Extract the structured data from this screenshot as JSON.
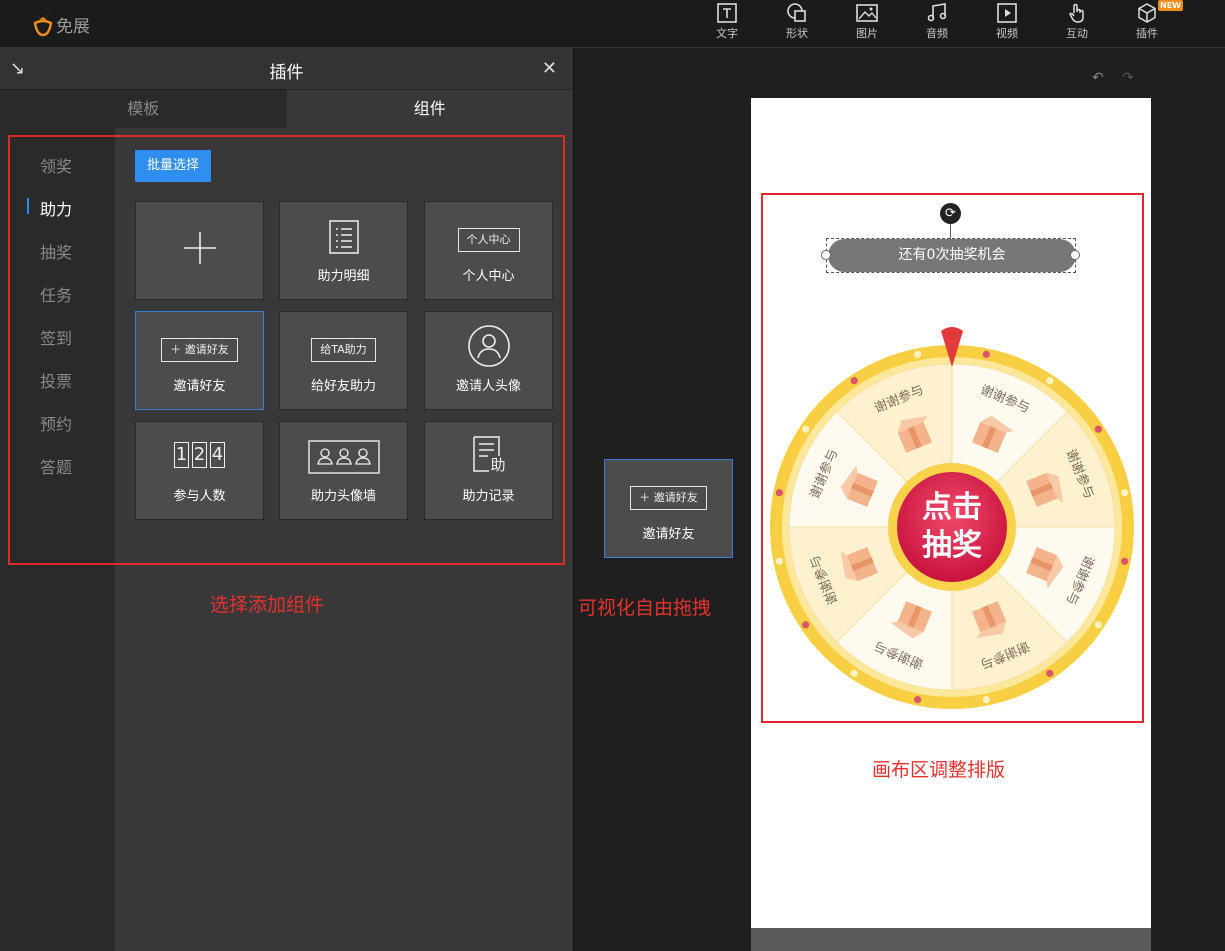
{
  "app": {
    "brand": "免展"
  },
  "toolbar": [
    {
      "label": "文字",
      "icon": "text-icon"
    },
    {
      "label": "形状",
      "icon": "shape-icon"
    },
    {
      "label": "图片",
      "icon": "image-icon"
    },
    {
      "label": "音频",
      "icon": "music-icon"
    },
    {
      "label": "视频",
      "icon": "video-icon"
    },
    {
      "label": "互动",
      "icon": "hand-icon"
    },
    {
      "label": "插件",
      "icon": "cube-icon",
      "badge": "NEW"
    }
  ],
  "panel": {
    "title": "插件",
    "tabs": [
      {
        "label": "模板",
        "active": false
      },
      {
        "label": "组件",
        "active": true
      }
    ],
    "categories": [
      {
        "label": "领奖",
        "active": false
      },
      {
        "label": "助力",
        "active": true
      },
      {
        "label": "抽奖",
        "active": false
      },
      {
        "label": "任务",
        "active": false
      },
      {
        "label": "签到",
        "active": false
      },
      {
        "label": "投票",
        "active": false
      },
      {
        "label": "预约",
        "active": false
      },
      {
        "label": "答题",
        "active": false
      }
    ],
    "batch_button": "批量选择",
    "components": [
      {
        "label": "",
        "icon": "plus-icon"
      },
      {
        "label": "助力明细",
        "icon": "list-icon"
      },
      {
        "label": "个人中心",
        "icon": "personal-center-button-icon",
        "preview": "个人中心"
      },
      {
        "label": "邀请好友",
        "icon": "invite-button-icon",
        "preview": "邀请好友"
      },
      {
        "label": "给好友助力",
        "icon": "help-button-icon",
        "preview": "给TA助力"
      },
      {
        "label": "邀请人头像",
        "icon": "avatar-icon"
      },
      {
        "label": "参与人数",
        "icon": "counter-icon",
        "preview": "124"
      },
      {
        "label": "助力头像墙",
        "icon": "avatar-wall-icon"
      },
      {
        "label": "助力记录",
        "icon": "record-icon",
        "preview": "助"
      }
    ]
  },
  "dragging": {
    "label": "邀请好友",
    "preview": "邀请好友"
  },
  "canvas": {
    "chance_text": "还有0次抽奖机会",
    "wheel": {
      "center_text_1": "点击",
      "center_text_2": "抽奖",
      "prizes": [
        "谢谢参与",
        "谢谢参与",
        "谢谢参与",
        "谢谢参与",
        "谢谢参与",
        "谢谢参与",
        "谢谢参与",
        "谢谢参与"
      ]
    }
  },
  "annotations": {
    "select": "选择添加组件",
    "drag": "可视化自由拖拽",
    "layout": "画布区调整排版"
  },
  "colors": {
    "accent": "#2f8ff0",
    "annotation": "#e5322d",
    "wheel_rim": "#f7d24a",
    "wheel_center": "#d81e4b"
  }
}
